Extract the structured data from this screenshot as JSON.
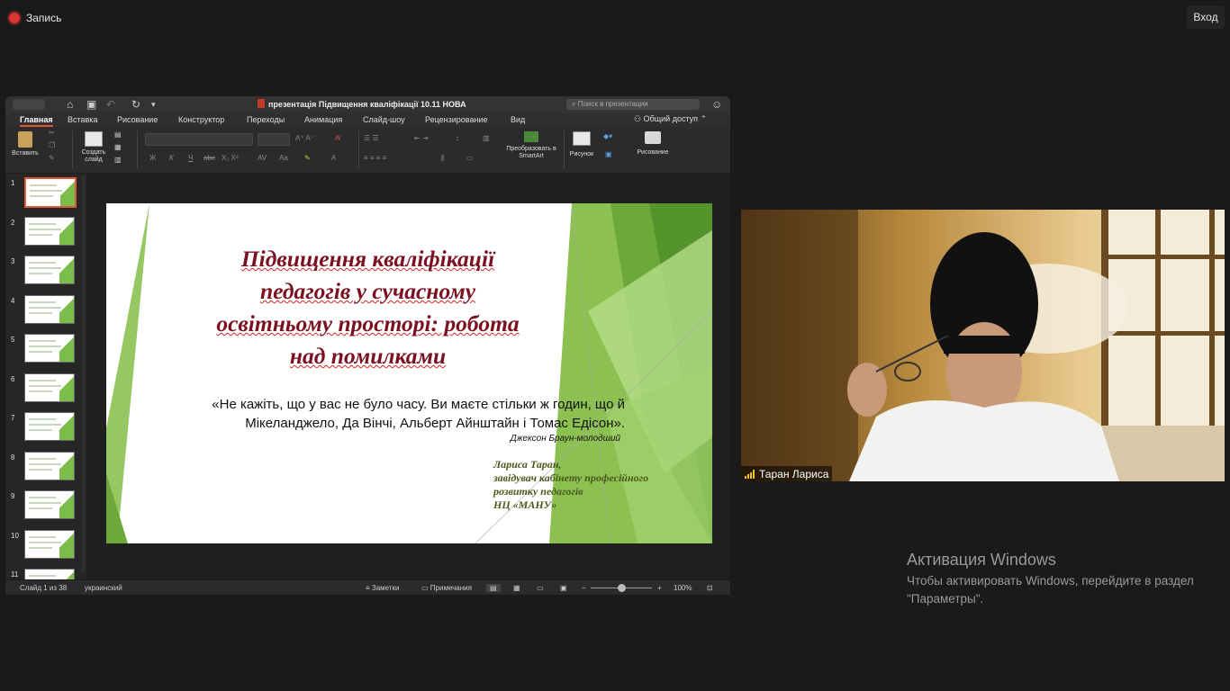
{
  "top": {
    "record_label": "Запись",
    "enter_label": "Вход"
  },
  "ppt": {
    "title": "презентація Підвищення кваліфікації 10.11 НОВА",
    "search_placeholder": "Поиск в презентации",
    "tabs": [
      "Главная",
      "Вставка",
      "Рисование",
      "Конструктор",
      "Переходы",
      "Анимация",
      "Слайд-шоу",
      "Рецензирование",
      "Вид"
    ],
    "share_label": "Общий доступ",
    "ribbon": {
      "paste": "Вставить",
      "new_slide": "Создать слайд",
      "smartart": "Преобразовать в SmartArt",
      "picture": "Рисунок",
      "drawing": "Рисование"
    },
    "slide_numbers": [
      "1",
      "2",
      "3",
      "4",
      "5",
      "6",
      "7",
      "8",
      "9",
      "10",
      "11"
    ],
    "slide": {
      "title_lines": [
        "Підвищення кваліфікації",
        "педагогів у сучасному",
        "освітньому просторі: робота",
        "над помилками"
      ],
      "quote_lines": [
        "«Не кажіть, що у вас не було часу. Ви маєте стільки ж годин, що й",
        "Мікеланджело, Да Вінчі, Альберт Айнштайн і Томас Едісон»."
      ],
      "quote_author": "Джексон Браун-молодший",
      "author_lines": [
        "Лариса Таран,",
        "завідувач кабінету професійного",
        "розвитку педагогів",
        "НЦ «МАНУ»"
      ]
    },
    "status": {
      "slide_counter": "Слайд 1 из 38",
      "language": "украинский",
      "notes": "Заметки",
      "comments": "Примечания",
      "zoom": "100%"
    }
  },
  "video": {
    "participant_name": "Таран Лариса"
  },
  "activation": {
    "title": "Активация Windows",
    "text": "Чтобы активировать Windows, перейдите в раздел \"Параметры\"."
  },
  "colors": {
    "accent_tab": "#e05a3a",
    "slide_title": "#7b1020",
    "slide_green": "#7cbc4a",
    "author_text": "#4a5a1a"
  }
}
